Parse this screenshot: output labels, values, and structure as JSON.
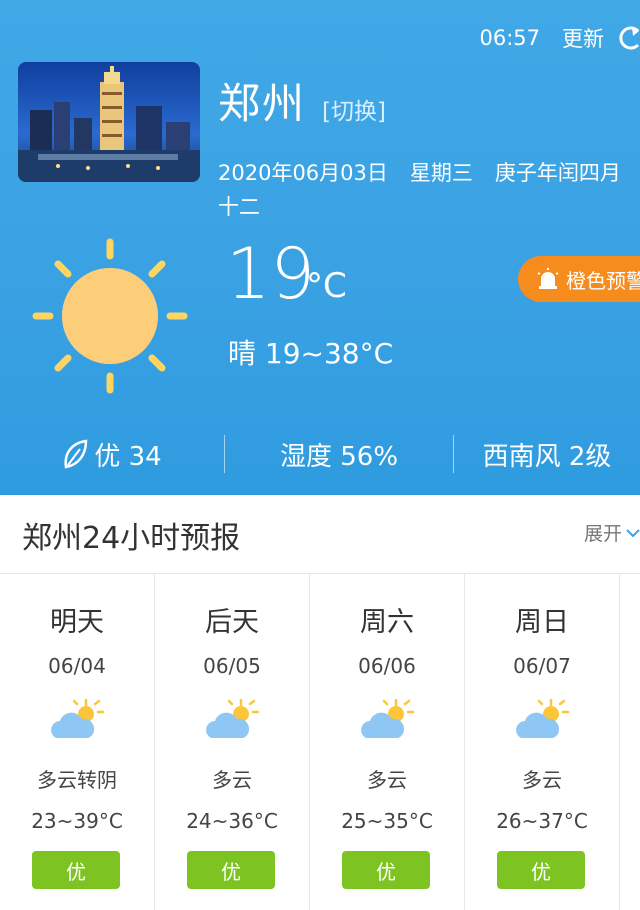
{
  "header": {
    "time": "06:57",
    "refresh_label": "更新",
    "city": "郑州",
    "switch_label": "[切换]",
    "date": "2020年06月03日",
    "weekday": "星期三",
    "lunar": "庚子年闰四月十二"
  },
  "current": {
    "temperature": "19",
    "unit": "°C",
    "summary": "晴 19~38°C",
    "alert": "橙色预警"
  },
  "stats": {
    "air": "优 34",
    "humidity": "湿度 56%",
    "wind": "西南风 2级"
  },
  "forecast_section": {
    "title": "郑州24小时预报",
    "expand_label": "展开"
  },
  "forecast": [
    {
      "day": "明天",
      "date": "06/04",
      "cond": "多云转阴",
      "range": "23~39°C",
      "aqi": "优",
      "icon": "partly-cloudy-icon"
    },
    {
      "day": "后天",
      "date": "06/05",
      "cond": "多云",
      "range": "24~36°C",
      "aqi": "优",
      "icon": "partly-cloudy-icon"
    },
    {
      "day": "周六",
      "date": "06/06",
      "cond": "多云",
      "range": "25~35°C",
      "aqi": "优",
      "icon": "partly-cloudy-icon"
    },
    {
      "day": "周日",
      "date": "06/07",
      "cond": "多云",
      "range": "26~37°C",
      "aqi": "优",
      "icon": "partly-cloudy-icon"
    }
  ],
  "colors": {
    "hero_blue": "#3aa2e3",
    "alert_orange": "#f78c1e",
    "aqi_green": "#7dc322",
    "sun_yellow": "#fdd560"
  }
}
